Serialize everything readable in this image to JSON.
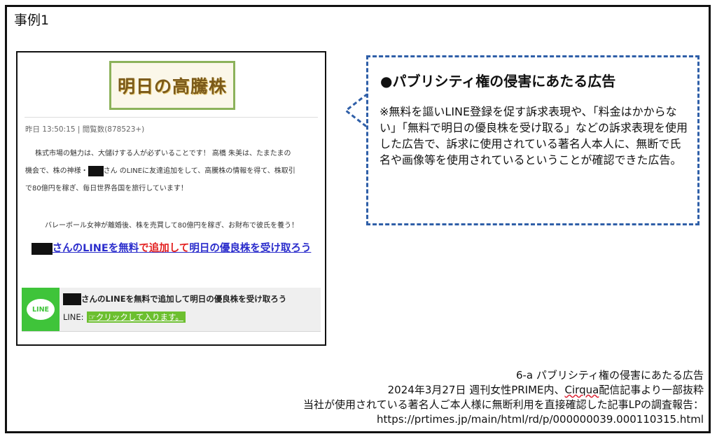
{
  "case_label": "事例1",
  "screenshot": {
    "logo_text": "明日の高騰株",
    "meta": "昨日 13:50:15 | 閲覧数(878523+)",
    "para1_a": "株式市場の魅力は、大儲けする人が必ずいることです！ 高橋 朱美は、たまたまの",
    "para1_b": "機会で、株の神様・",
    "para1_c": "さん のLINEに友達追加をして、高騰株の情報を得て、株取引",
    "para1_d": "で80億円を稼ぎ、毎日世界各国を旅行しています！",
    "para2": "バレーボール女神が離婚後、株を売買して80億円を稼ぎ、お財布で彼氏を養う！",
    "cta_a": "さんのLINEを無料",
    "cta_red": "で追加して",
    "cta_b": "明日の優良株を受け取ろう",
    "line_icon_text": "LINE",
    "line_title": "さんのLINEを無料で追加して明日の優良株を受け取ろう",
    "line_label": "LINE:",
    "line_link": "☞クリックして入ります。"
  },
  "callout": {
    "title": "●パブリシティ権の侵害にあたる広告",
    "body": "※無料を謳いLINE登録を促す訴求表現や、「料金はかからない」「無料で明日の優良株を受け取る」などの訴求表現を使用した広告で、訴求に使用されている著名人本人に、無断で氏名や画像等を使用されているということが確認できた広告。",
    "border_color": "#2f5fa8"
  },
  "footer": {
    "line1": "6-a パブリシティ権の侵害にあたる広告",
    "line2_a": "2024年3月27日 週刊女性PRIME内、",
    "line2_b": "Cirqua",
    "line2_c": "配信記事より一部抜粋",
    "line3": "当社が使用されている著名人ご本人様に無断利用を直接確認した記事LPの調査報告：",
    "line4": "https://prtimes.jp/main/html/rd/p/000000039.000110315.html"
  }
}
